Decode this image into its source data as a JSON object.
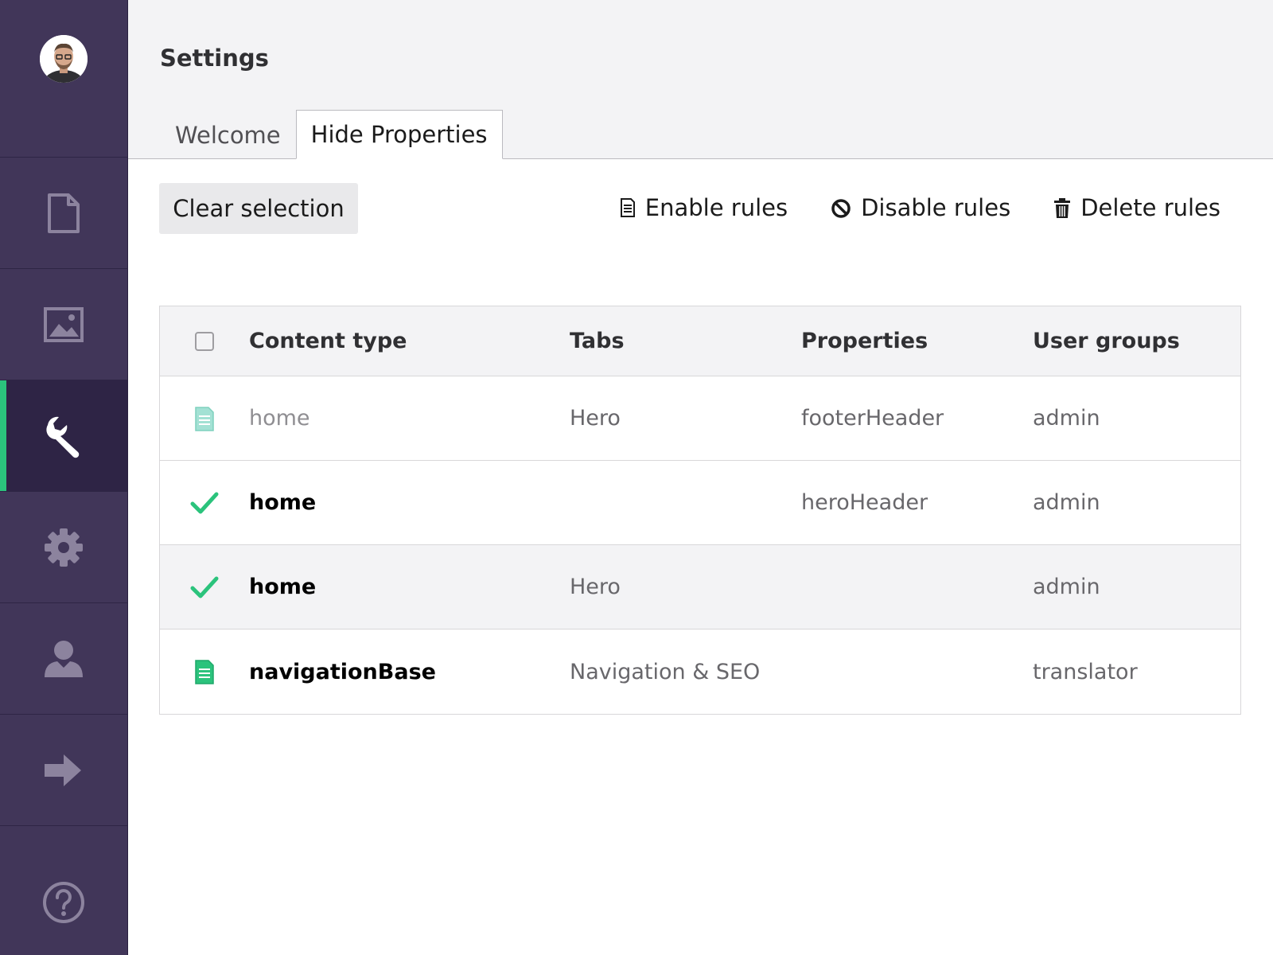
{
  "sidebar": {
    "items": [
      {
        "name": "content",
        "icon": "document-icon"
      },
      {
        "name": "media",
        "icon": "image-icon"
      },
      {
        "name": "settings-tools",
        "icon": "wrench-icon",
        "active": true
      },
      {
        "name": "developer",
        "icon": "gear-icon"
      },
      {
        "name": "users",
        "icon": "user-icon"
      },
      {
        "name": "forms",
        "icon": "arrow-right-icon"
      }
    ],
    "help_icon": "help-icon",
    "accent_color": "#2bc37c",
    "background_color": "#413659"
  },
  "header": {
    "title": "Settings",
    "tabs": [
      {
        "label": "Welcome",
        "active": false
      },
      {
        "label": "Hide Properties",
        "active": true
      }
    ]
  },
  "toolbar": {
    "clear_label": "Clear selection",
    "enable_label": "Enable rules",
    "disable_label": "Disable rules",
    "delete_label": "Delete rules"
  },
  "table": {
    "columns": [
      "Content type",
      "Tabs",
      "Properties",
      "User groups"
    ],
    "rows": [
      {
        "status_icon": "document-icon",
        "content_type": "home",
        "tabs": "Hero",
        "properties": "footerHeader",
        "user_groups": "admin",
        "disabled": true
      },
      {
        "status_icon": "check-icon",
        "content_type": "home",
        "tabs": "",
        "properties": "heroHeader",
        "user_groups": "admin"
      },
      {
        "status_icon": "check-icon",
        "content_type": "home",
        "tabs": "Hero",
        "properties": "",
        "user_groups": "admin"
      },
      {
        "status_icon": "document-icon",
        "content_type": "navigationBase",
        "tabs": "Navigation & SEO",
        "properties": "",
        "user_groups": "translator"
      }
    ]
  }
}
